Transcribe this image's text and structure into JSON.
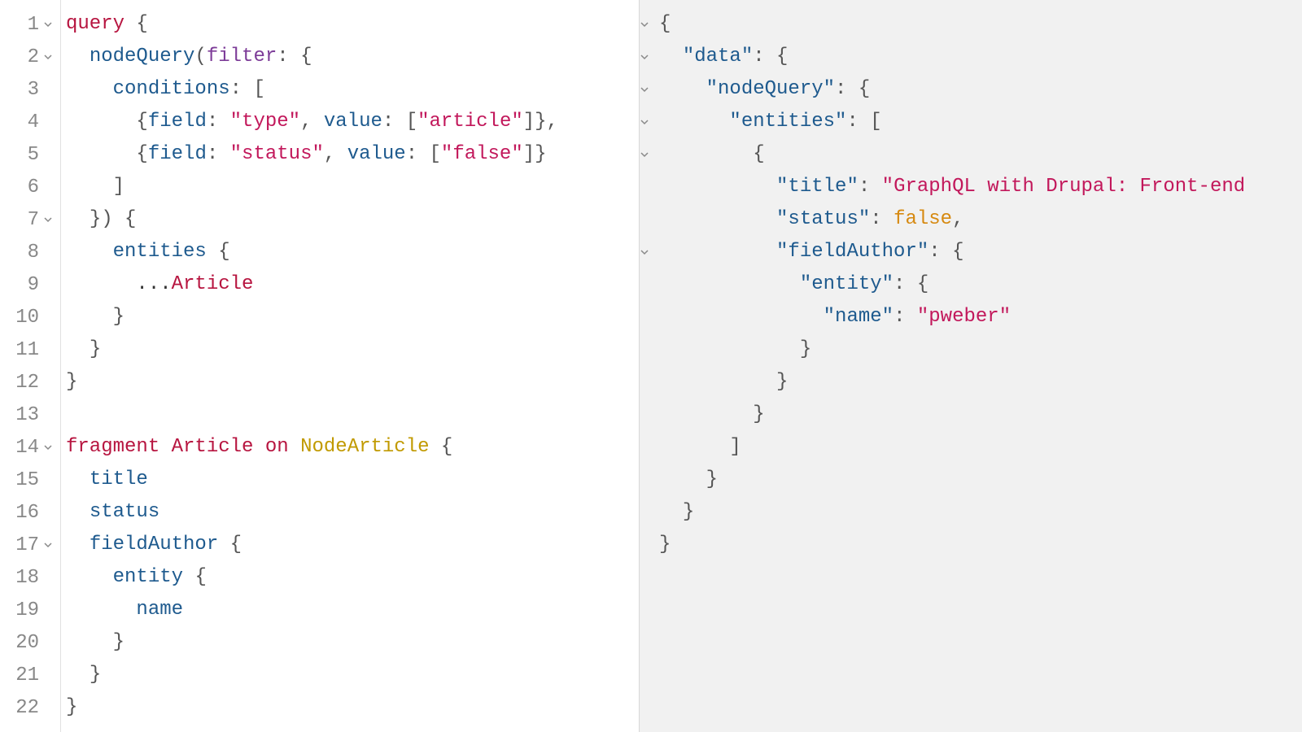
{
  "editor": {
    "lineCount": 22,
    "foldLines": [
      1,
      2,
      7,
      14,
      17
    ],
    "tokens": [
      [
        {
          "t": "keyword",
          "v": "query"
        },
        {
          "t": "plain",
          "v": " "
        },
        {
          "t": "punct",
          "v": "{"
        }
      ],
      [
        {
          "t": "plain",
          "v": "  "
        },
        {
          "t": "prop",
          "v": "nodeQuery"
        },
        {
          "t": "punct",
          "v": "("
        },
        {
          "t": "def",
          "v": "filter"
        },
        {
          "t": "punct",
          "v": ": {"
        }
      ],
      [
        {
          "t": "plain",
          "v": "    "
        },
        {
          "t": "attr",
          "v": "conditions"
        },
        {
          "t": "punct",
          "v": ": ["
        }
      ],
      [
        {
          "t": "plain",
          "v": "      "
        },
        {
          "t": "punct",
          "v": "{"
        },
        {
          "t": "attr",
          "v": "field"
        },
        {
          "t": "punct",
          "v": ": "
        },
        {
          "t": "string",
          "v": "\"type\""
        },
        {
          "t": "punct",
          "v": ", "
        },
        {
          "t": "attr",
          "v": "value"
        },
        {
          "t": "punct",
          "v": ": ["
        },
        {
          "t": "string",
          "v": "\"article\""
        },
        {
          "t": "punct",
          "v": "]},"
        }
      ],
      [
        {
          "t": "plain",
          "v": "      "
        },
        {
          "t": "punct",
          "v": "{"
        },
        {
          "t": "attr",
          "v": "field"
        },
        {
          "t": "punct",
          "v": ": "
        },
        {
          "t": "string",
          "v": "\"status\""
        },
        {
          "t": "punct",
          "v": ", "
        },
        {
          "t": "attr",
          "v": "value"
        },
        {
          "t": "punct",
          "v": ": ["
        },
        {
          "t": "string",
          "v": "\"false\""
        },
        {
          "t": "punct",
          "v": "]}"
        }
      ],
      [
        {
          "t": "plain",
          "v": "    "
        },
        {
          "t": "punct",
          "v": "]"
        }
      ],
      [
        {
          "t": "plain",
          "v": "  "
        },
        {
          "t": "punct",
          "v": "}) {"
        }
      ],
      [
        {
          "t": "plain",
          "v": "    "
        },
        {
          "t": "prop",
          "v": "entities"
        },
        {
          "t": "plain",
          "v": " "
        },
        {
          "t": "punct",
          "v": "{"
        }
      ],
      [
        {
          "t": "plain",
          "v": "      ..."
        },
        {
          "t": "keyword",
          "v": "Article"
        }
      ],
      [
        {
          "t": "plain",
          "v": "    "
        },
        {
          "t": "punct",
          "v": "}"
        }
      ],
      [
        {
          "t": "plain",
          "v": "  "
        },
        {
          "t": "punct",
          "v": "}"
        }
      ],
      [
        {
          "t": "punct",
          "v": "}"
        }
      ],
      [],
      [
        {
          "t": "keyword",
          "v": "fragment"
        },
        {
          "t": "plain",
          "v": " "
        },
        {
          "t": "keyword",
          "v": "Article"
        },
        {
          "t": "plain",
          "v": " "
        },
        {
          "t": "keyword",
          "v": "on"
        },
        {
          "t": "plain",
          "v": " "
        },
        {
          "t": "type",
          "v": "NodeArticle"
        },
        {
          "t": "plain",
          "v": " "
        },
        {
          "t": "punct",
          "v": "{"
        }
      ],
      [
        {
          "t": "plain",
          "v": "  "
        },
        {
          "t": "prop",
          "v": "title"
        }
      ],
      [
        {
          "t": "plain",
          "v": "  "
        },
        {
          "t": "prop",
          "v": "status"
        }
      ],
      [
        {
          "t": "plain",
          "v": "  "
        },
        {
          "t": "prop",
          "v": "fieldAuthor"
        },
        {
          "t": "plain",
          "v": " "
        },
        {
          "t": "punct",
          "v": "{"
        }
      ],
      [
        {
          "t": "plain",
          "v": "    "
        },
        {
          "t": "prop",
          "v": "entity"
        },
        {
          "t": "plain",
          "v": " "
        },
        {
          "t": "punct",
          "v": "{"
        }
      ],
      [
        {
          "t": "plain",
          "v": "      "
        },
        {
          "t": "prop",
          "v": "name"
        }
      ],
      [
        {
          "t": "plain",
          "v": "    "
        },
        {
          "t": "punct",
          "v": "}"
        }
      ],
      [
        {
          "t": "plain",
          "v": "  "
        },
        {
          "t": "punct",
          "v": "}"
        }
      ],
      [
        {
          "t": "punct",
          "v": "}"
        }
      ]
    ]
  },
  "result": {
    "foldLines": [
      1,
      2,
      3,
      4,
      5,
      8
    ],
    "tokens": [
      [
        {
          "t": "punct",
          "v": "{"
        }
      ],
      [
        {
          "t": "plain",
          "v": "  "
        },
        {
          "t": "prop",
          "v": "\"data\""
        },
        {
          "t": "punct",
          "v": ": {"
        }
      ],
      [
        {
          "t": "plain",
          "v": "    "
        },
        {
          "t": "prop",
          "v": "\"nodeQuery\""
        },
        {
          "t": "punct",
          "v": ": {"
        }
      ],
      [
        {
          "t": "plain",
          "v": "      "
        },
        {
          "t": "prop",
          "v": "\"entities\""
        },
        {
          "t": "punct",
          "v": ": ["
        }
      ],
      [
        {
          "t": "plain",
          "v": "        "
        },
        {
          "t": "punct",
          "v": "{"
        }
      ],
      [
        {
          "t": "plain",
          "v": "          "
        },
        {
          "t": "prop",
          "v": "\"title\""
        },
        {
          "t": "punct",
          "v": ": "
        },
        {
          "t": "string",
          "v": "\"GraphQL with Drupal: Front-end"
        }
      ],
      [
        {
          "t": "plain",
          "v": "          "
        },
        {
          "t": "prop",
          "v": "\"status\""
        },
        {
          "t": "punct",
          "v": ": "
        },
        {
          "t": "bool",
          "v": "false"
        },
        {
          "t": "punct",
          "v": ","
        }
      ],
      [
        {
          "t": "plain",
          "v": "          "
        },
        {
          "t": "prop",
          "v": "\"fieldAuthor\""
        },
        {
          "t": "punct",
          "v": ": {"
        }
      ],
      [
        {
          "t": "plain",
          "v": "            "
        },
        {
          "t": "prop",
          "v": "\"entity\""
        },
        {
          "t": "punct",
          "v": ": {"
        }
      ],
      [
        {
          "t": "plain",
          "v": "              "
        },
        {
          "t": "prop",
          "v": "\"name\""
        },
        {
          "t": "punct",
          "v": ": "
        },
        {
          "t": "string",
          "v": "\"pweber\""
        }
      ],
      [
        {
          "t": "plain",
          "v": "            "
        },
        {
          "t": "punct",
          "v": "}"
        }
      ],
      [
        {
          "t": "plain",
          "v": "          "
        },
        {
          "t": "punct",
          "v": "}"
        }
      ],
      [
        {
          "t": "plain",
          "v": "        "
        },
        {
          "t": "punct",
          "v": "}"
        }
      ],
      [
        {
          "t": "plain",
          "v": "      "
        },
        {
          "t": "punct",
          "v": "]"
        }
      ],
      [
        {
          "t": "plain",
          "v": "    "
        },
        {
          "t": "punct",
          "v": "}"
        }
      ],
      [
        {
          "t": "plain",
          "v": "  "
        },
        {
          "t": "punct",
          "v": "}"
        }
      ],
      [
        {
          "t": "punct",
          "v": "}"
        }
      ]
    ]
  }
}
